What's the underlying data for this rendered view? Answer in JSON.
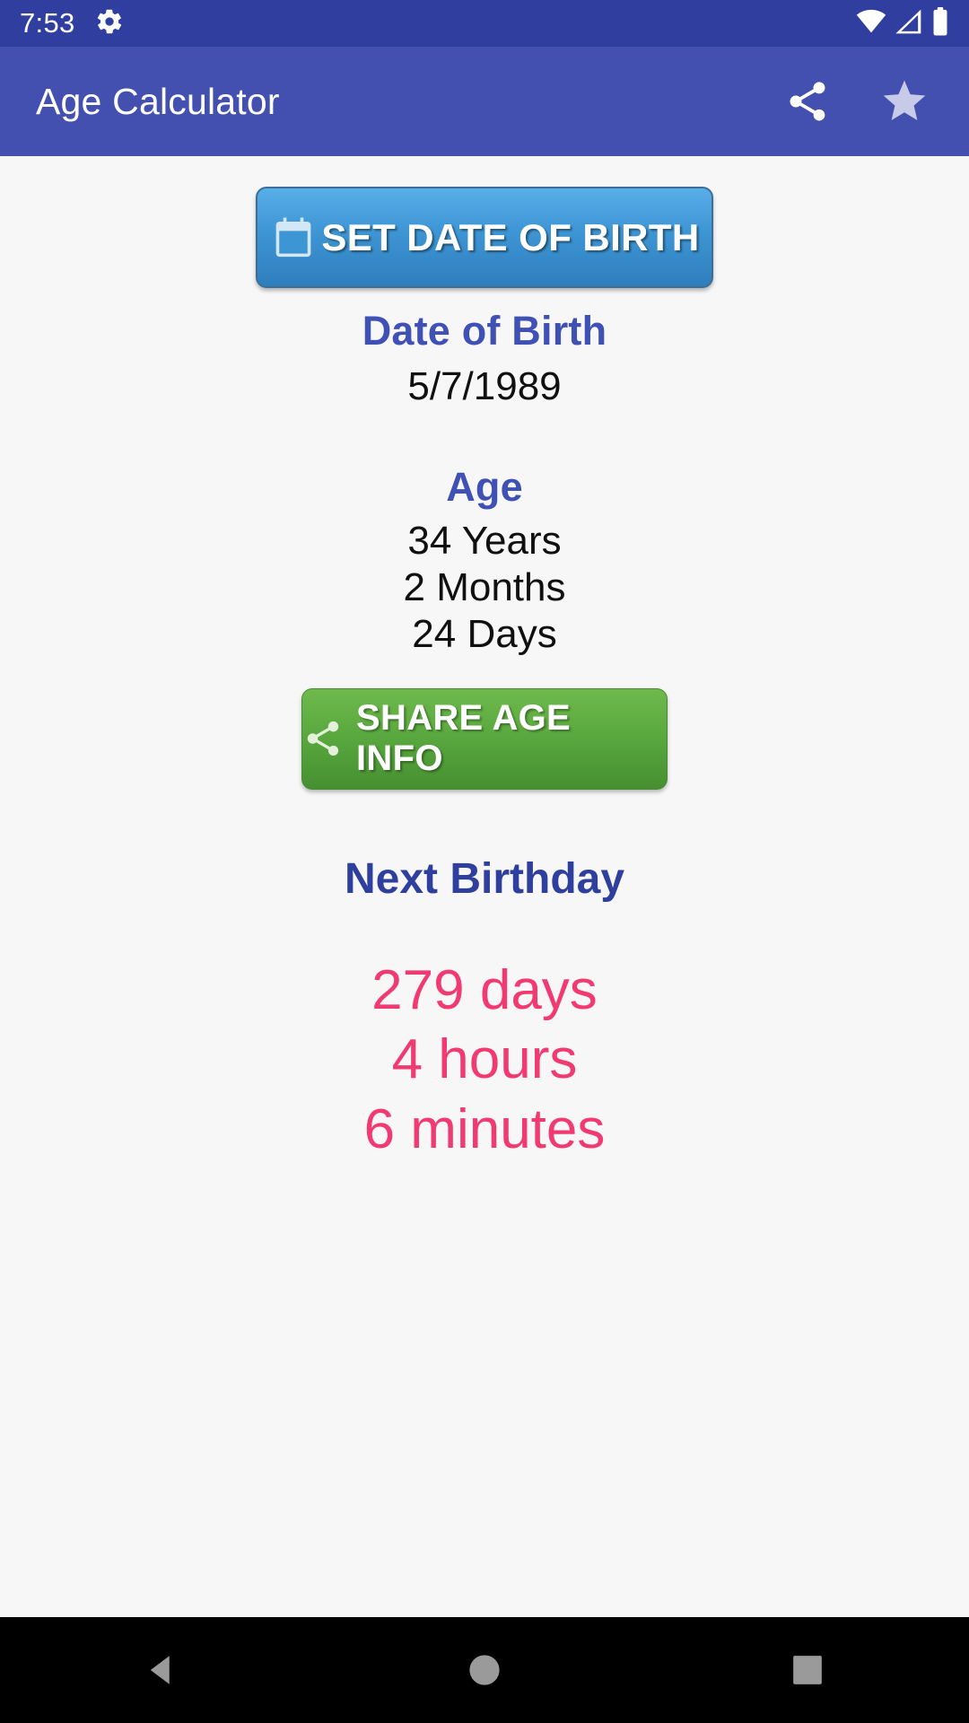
{
  "status_bar": {
    "clock": "7:53",
    "icons": [
      "gear-icon",
      "wifi-icon",
      "cell-signal-icon",
      "battery-icon"
    ]
  },
  "app_bar": {
    "title": "Age Calculator",
    "actions": [
      {
        "name": "share-icon",
        "label": "Share"
      },
      {
        "name": "star-icon",
        "label": "Favorite"
      }
    ]
  },
  "main": {
    "set_dob_button": {
      "label": "SET DATE OF BIRTH",
      "icon": "calendar-icon",
      "color": "#3E95D4"
    },
    "dob_section": {
      "heading": "Date of Birth",
      "value": "5/7/1989"
    },
    "age_section": {
      "heading": "Age",
      "years": "34 Years",
      "months": "2 Months",
      "days": "24 Days"
    },
    "share_button": {
      "label": "SHARE AGE INFO",
      "icon": "share-icon",
      "color": "#59A83E"
    },
    "next_birthday_section": {
      "heading": "Next Birthday",
      "days": "279 days",
      "hours": "4 hours",
      "minutes": "6 minutes",
      "color": "#F23A72"
    }
  },
  "nav_bar": {
    "back": "back-triangle-icon",
    "home": "home-circle-icon",
    "recents": "recents-square-icon"
  },
  "colors": {
    "status_bar": "#303F9F",
    "app_bar": "#4350AF",
    "heading_blue": "#3F51B5",
    "background": "#F7F7F7"
  }
}
